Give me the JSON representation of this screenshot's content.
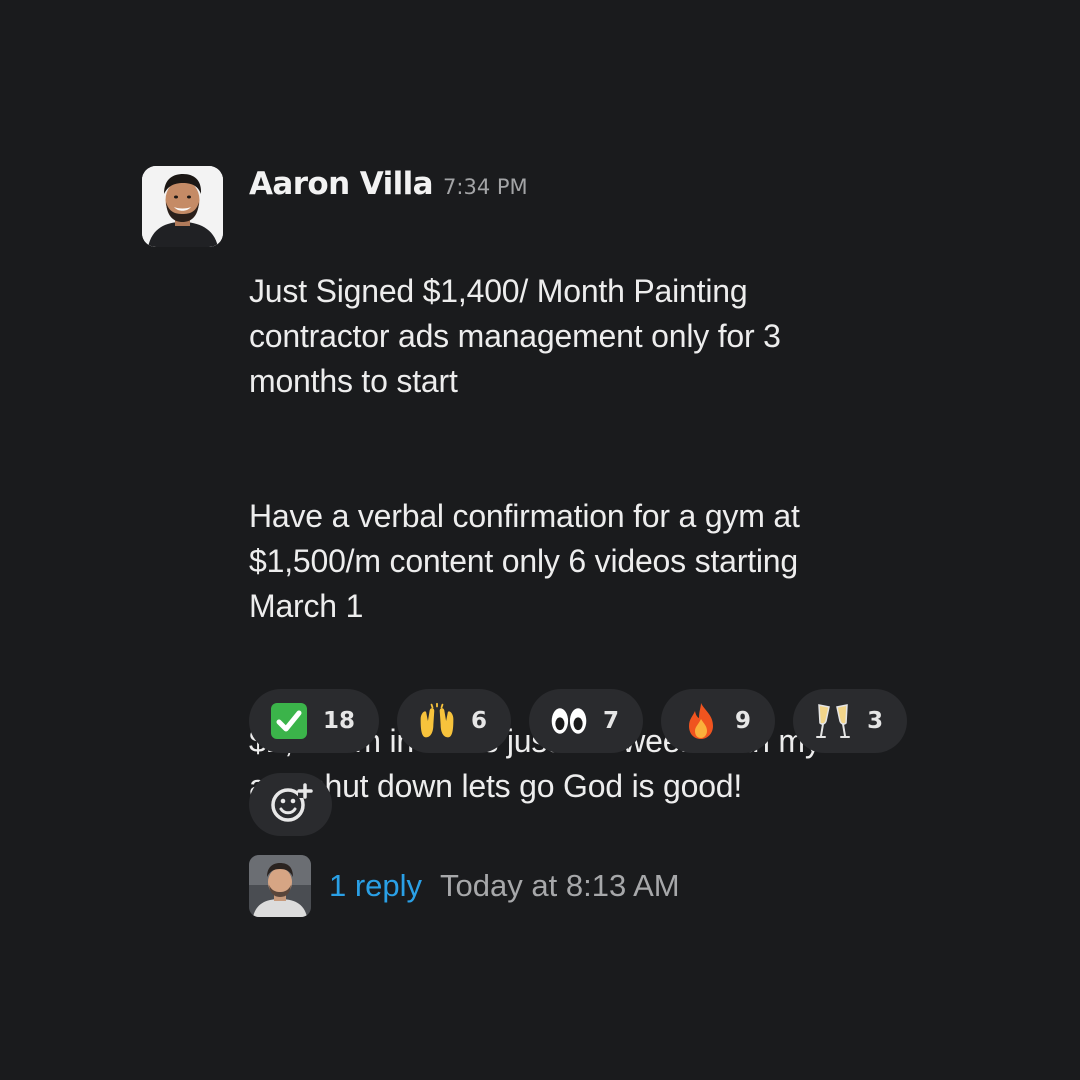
{
  "message": {
    "author": "Aaron Villa",
    "time": "7:34 PM",
    "paragraphs": [
      "Just Signed $1,400/ Month Painting\ncontractor ads management only for 3\nmonths to start",
      "Have a verbal confirmation for a gym at\n$1,500/m content only 6 videos starting\nMarch 1",
      "$2,900/m in deals just this week. with my\nads shut down lets go God is good!"
    ]
  },
  "reactions": [
    {
      "icon": "check-mark-icon",
      "count": "18"
    },
    {
      "icon": "raising-hands-icon",
      "count": "6"
    },
    {
      "icon": "eyes-icon",
      "count": "7"
    },
    {
      "icon": "fire-icon",
      "count": "9"
    },
    {
      "icon": "clinking-glasses-icon",
      "count": "3"
    }
  ],
  "thread": {
    "reply_label": "1 reply",
    "reply_time": "Today at 8:13 AM"
  },
  "colors": {
    "background": "#1a1b1d",
    "reaction_bg": "#2a2b2e",
    "link": "#2aa0e6",
    "muted": "#a3a4a6"
  }
}
